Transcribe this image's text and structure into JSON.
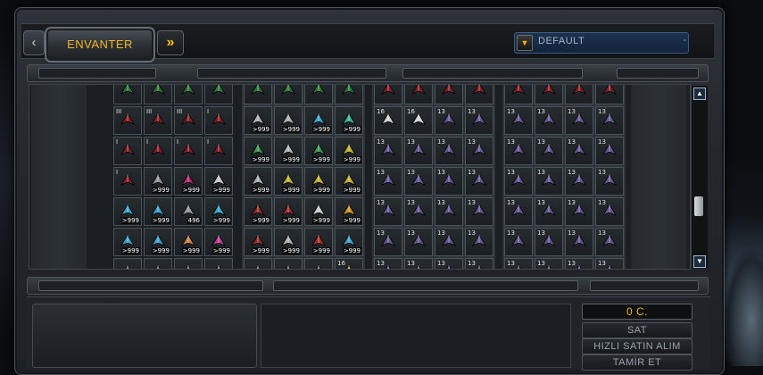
{
  "header": {
    "tab_label": "ENVANTER",
    "nav_prev_glyph": "‹",
    "nav_next_glyph": "»",
    "filter": {
      "value": "DEFAULT",
      "arrow_glyph": "▼",
      "trailing_mark": "-"
    }
  },
  "inventory": {
    "groups": [
      {
        "name": "group-1",
        "rows": [
          [
            {
              "icon": "green-item-icon",
              "color": "#2e7a3a"
            },
            {
              "icon": "green-item-icon",
              "color": "#2e7a3a"
            },
            {
              "icon": "green-item-icon",
              "color": "#2e7a3a"
            },
            {
              "icon": "green-item-icon",
              "color": "#2e7a3a"
            }
          ],
          [
            {
              "icon": "red-armor-icon",
              "color": "#8a1c24",
              "badge": "III"
            },
            {
              "icon": "red-armor-icon",
              "color": "#8a1c24",
              "badge": "III"
            },
            {
              "icon": "red-armor-icon",
              "color": "#8a1c24",
              "badge": "III"
            },
            {
              "icon": "red-armor-icon",
              "color": "#8a1c24",
              "badge": "I"
            }
          ],
          [
            {
              "icon": "red-armor-icon",
              "color": "#8a1c24",
              "badge": "I"
            },
            {
              "icon": "red-armor-icon",
              "color": "#8a1c24",
              "badge": "I"
            },
            {
              "icon": "red-armor-icon",
              "color": "#8a1c24",
              "badge": "I"
            },
            {
              "icon": "red-armor-icon",
              "color": "#8a1c24",
              "badge": "I"
            }
          ],
          [
            {
              "icon": "red-armor-icon",
              "color": "#8a1c24",
              "badge": "I"
            },
            {
              "icon": "grey-module-icon",
              "color": "#9aa0a6",
              "count": ">999"
            },
            {
              "icon": "pink-module-icon",
              "color": "#c02878",
              "count": ">999"
            },
            {
              "icon": "white-box-icon",
              "color": "#d8d8d8",
              "count": ">999"
            }
          ],
          [
            {
              "icon": "cyan-weapon-icon",
              "color": "#3ab0d8",
              "count": ">999"
            },
            {
              "icon": "cyan-weapon-icon",
              "color": "#3ab0d8",
              "count": ">999"
            },
            {
              "icon": "grey-module-icon",
              "color": "#9aa0a6",
              "count": "496"
            },
            {
              "icon": "cyan-module-icon",
              "color": "#3ab0d8",
              "count": ">999"
            }
          ],
          [
            {
              "icon": "cyan-weapon-icon",
              "color": "#3ab0d8",
              "count": ">999"
            },
            {
              "icon": "cyan-box-icon",
              "color": "#3ab0d8",
              "count": ">999"
            },
            {
              "icon": "orange-box-icon",
              "color": "#e08a3a",
              "count": ">999"
            },
            {
              "icon": "pink-box-icon",
              "color": "#d040a0",
              "count": ">999"
            }
          ],
          [
            {
              "icon": "grey-item-icon",
              "color": "#777d83"
            },
            {
              "icon": "grey-item-icon",
              "color": "#777d83"
            },
            {
              "icon": "grey-item-icon",
              "color": "#777d83"
            },
            {
              "icon": "grey-item-icon",
              "color": "#777d83"
            }
          ]
        ]
      },
      {
        "name": "group-2",
        "rows": [
          [
            {
              "icon": "green-item-icon",
              "color": "#2e7a3a"
            },
            {
              "icon": "green-item-icon",
              "color": "#2e7a3a"
            },
            {
              "icon": "green-item-icon",
              "color": "#2e7a3a"
            },
            {
              "icon": "green-item-icon",
              "color": "#2e7a3a"
            }
          ],
          [
            {
              "icon": "grey-weapon-icon",
              "color": "#b8bcc0",
              "count": ">999"
            },
            {
              "icon": "grey-weapon-icon",
              "color": "#b8bcc0",
              "count": ">999"
            },
            {
              "icon": "cyan-weapon-icon",
              "color": "#3ab0d8",
              "count": ">999"
            },
            {
              "icon": "cyan-pack-icon",
              "color": "#3ac0a0",
              "count": ">999"
            }
          ],
          [
            {
              "icon": "green-box-icon",
              "color": "#3aa050",
              "count": ">999"
            },
            {
              "icon": "grey-box-icon",
              "color": "#c0c4c8",
              "count": ">999"
            },
            {
              "icon": "green-box-icon",
              "color": "#3aa050",
              "count": ">999"
            },
            {
              "icon": "yellow-box-icon",
              "color": "#d0c030",
              "count": ">999"
            }
          ],
          [
            {
              "icon": "grey-weapon-icon",
              "color": "#b8bcc0",
              "count": ">999"
            },
            {
              "icon": "yellow-box-icon",
              "color": "#d0c030",
              "count": ">999"
            },
            {
              "icon": "yellow-box-icon",
              "color": "#d0c030",
              "count": ">999"
            },
            {
              "icon": "yellow-box-icon",
              "color": "#d0c030",
              "count": ">999"
            }
          ],
          [
            {
              "icon": "red-box-icon",
              "color": "#a02a2a",
              "count": ">999"
            },
            {
              "icon": "red-box-icon",
              "color": "#a02a2a",
              "count": ">999"
            },
            {
              "icon": "white-box-icon",
              "color": "#d8d8d8",
              "count": ">999"
            },
            {
              "icon": "orange-module-icon",
              "color": "#e0a020",
              "count": ">999"
            }
          ],
          [
            {
              "icon": "red-box-icon",
              "color": "#a02a2a",
              "count": ">999"
            },
            {
              "icon": "grey-weapon-icon",
              "color": "#b8bcc0",
              "count": ">999"
            },
            {
              "icon": "red-weapon-icon",
              "color": "#c02a2a",
              "count": ">999"
            },
            {
              "icon": "cyan-weapon-icon",
              "color": "#3ab0d8",
              "count": ">999"
            }
          ],
          [
            {
              "icon": "grey-item-icon",
              "color": "#777d83"
            },
            {
              "icon": "grey-item-icon",
              "color": "#777d83"
            },
            {
              "icon": "grey-item-icon",
              "color": "#777d83"
            },
            {
              "icon": "yellow-item-icon",
              "color": "#d0c030",
              "badge": "16"
            }
          ]
        ]
      },
      {
        "name": "group-3",
        "rows": [
          [
            {
              "icon": "red-item-icon",
              "color": "#8a1c24"
            },
            {
              "icon": "red-item-icon",
              "color": "#8a1c24"
            },
            {
              "icon": "red-item-icon",
              "color": "#8a1c24"
            },
            {
              "icon": "red-item-icon",
              "color": "#8a1c24"
            }
          ],
          [
            {
              "icon": "drone-icon",
              "color": "#e8e8e8",
              "badge": "16"
            },
            {
              "icon": "drone-icon",
              "color": "#e8e8e8",
              "badge": "16"
            },
            {
              "icon": "ship-icon",
              "color": "#6a5a9a",
              "badge": "13"
            },
            {
              "icon": "ship-icon",
              "color": "#6a5a9a",
              "badge": "13"
            }
          ],
          [
            {
              "icon": "ship-icon",
              "color": "#6a5a9a",
              "badge": "13"
            },
            {
              "icon": "ship-icon",
              "color": "#6a5a9a",
              "badge": "13"
            },
            {
              "icon": "ship-icon",
              "color": "#6a5a9a",
              "badge": "13"
            },
            {
              "icon": "ship-icon",
              "color": "#6a5a9a",
              "badge": "13"
            }
          ],
          [
            {
              "icon": "ship-icon",
              "color": "#6a5a9a",
              "badge": "13"
            },
            {
              "icon": "ship-icon",
              "color": "#6a5a9a",
              "badge": "13"
            },
            {
              "icon": "ship-icon",
              "color": "#6a5a9a",
              "badge": "13"
            },
            {
              "icon": "ship-icon",
              "color": "#6a5a9a",
              "badge": "13"
            }
          ],
          [
            {
              "icon": "ship-icon",
              "color": "#6a5a9a",
              "badge": "13"
            },
            {
              "icon": "ship-icon",
              "color": "#6a5a9a",
              "badge": "13"
            },
            {
              "icon": "ship-icon",
              "color": "#6a5a9a",
              "badge": "13"
            },
            {
              "icon": "ship-icon",
              "color": "#6a5a9a",
              "badge": "13"
            }
          ],
          [
            {
              "icon": "ship-icon",
              "color": "#6a5a9a",
              "badge": "13"
            },
            {
              "icon": "ship-icon",
              "color": "#6a5a9a",
              "badge": "13"
            },
            {
              "icon": "ship-icon",
              "color": "#6a5a9a",
              "badge": "13"
            },
            {
              "icon": "ship-icon",
              "color": "#6a5a9a",
              "badge": "13"
            }
          ],
          [
            {
              "icon": "ship-icon",
              "color": "#6a5a9a",
              "badge": "13"
            },
            {
              "icon": "ship-icon",
              "color": "#6a5a9a",
              "badge": "13"
            },
            {
              "icon": "ship-icon",
              "color": "#6a5a9a",
              "badge": "13"
            },
            {
              "icon": "ship-icon",
              "color": "#6a5a9a",
              "badge": "13"
            }
          ]
        ]
      },
      {
        "name": "group-4",
        "rows": [
          [
            {
              "icon": "red-item-icon",
              "color": "#8a1c24"
            },
            {
              "icon": "red-item-icon",
              "color": "#8a1c24"
            },
            {
              "icon": "red-item-icon",
              "color": "#8a1c24"
            },
            {
              "icon": "red-item-icon",
              "color": "#8a1c24"
            }
          ],
          [
            {
              "icon": "ship-icon",
              "color": "#6a5a9a",
              "badge": "13"
            },
            {
              "icon": "ship-icon",
              "color": "#6a5a9a",
              "badge": "13"
            },
            {
              "icon": "ship-icon",
              "color": "#6a5a9a",
              "badge": "13"
            },
            {
              "icon": "ship-icon",
              "color": "#6a5a9a",
              "badge": "13"
            }
          ],
          [
            {
              "icon": "ship-icon",
              "color": "#6a5a9a",
              "badge": "13"
            },
            {
              "icon": "ship-icon",
              "color": "#6a5a9a",
              "badge": "13"
            },
            {
              "icon": "ship-icon",
              "color": "#6a5a9a",
              "badge": "13"
            },
            {
              "icon": "ship-icon",
              "color": "#6a5a9a",
              "badge": "13"
            }
          ],
          [
            {
              "icon": "ship-icon",
              "color": "#6a5a9a",
              "badge": "13"
            },
            {
              "icon": "ship-icon",
              "color": "#6a5a9a",
              "badge": "13"
            },
            {
              "icon": "ship-icon",
              "color": "#6a5a9a",
              "badge": "13"
            },
            {
              "icon": "ship-icon",
              "color": "#6a5a9a",
              "badge": "13"
            }
          ],
          [
            {
              "icon": "ship-icon",
              "color": "#6a5a9a",
              "badge": "13"
            },
            {
              "icon": "ship-icon",
              "color": "#6a5a9a",
              "badge": "13"
            },
            {
              "icon": "ship-icon",
              "color": "#6a5a9a",
              "badge": "13"
            },
            {
              "icon": "ship-icon",
              "color": "#6a5a9a",
              "badge": "13"
            }
          ],
          [
            {
              "icon": "ship-icon",
              "color": "#6a5a9a",
              "badge": "13"
            },
            {
              "icon": "ship-icon",
              "color": "#6a5a9a",
              "badge": "13"
            },
            {
              "icon": "ship-icon",
              "color": "#6a5a9a",
              "badge": "13"
            },
            {
              "icon": "ship-icon",
              "color": "#6a5a9a",
              "badge": "13"
            }
          ],
          [
            {
              "icon": "ship-icon",
              "color": "#6a5a9a",
              "badge": "13"
            },
            {
              "icon": "ship-icon",
              "color": "#6a5a9a",
              "badge": "13"
            },
            {
              "icon": "ship-icon",
              "color": "#6a5a9a",
              "badge": "13"
            },
            {
              "icon": "ship-icon",
              "color": "#6a5a9a",
              "badge": "13"
            }
          ]
        ]
      }
    ]
  },
  "scrollbar": {
    "up_glyph": "▲",
    "down_glyph": "▼"
  },
  "actions": {
    "credits": "0 C.",
    "sell_label": "SAT",
    "quick_sell_label": "HIZLI SATIN ALIM",
    "repair_label": "TAMİR ET"
  },
  "colors": {
    "accent": "#f2b51e",
    "text_muted": "#9aa3ab",
    "select_bg": "#1d3350"
  }
}
